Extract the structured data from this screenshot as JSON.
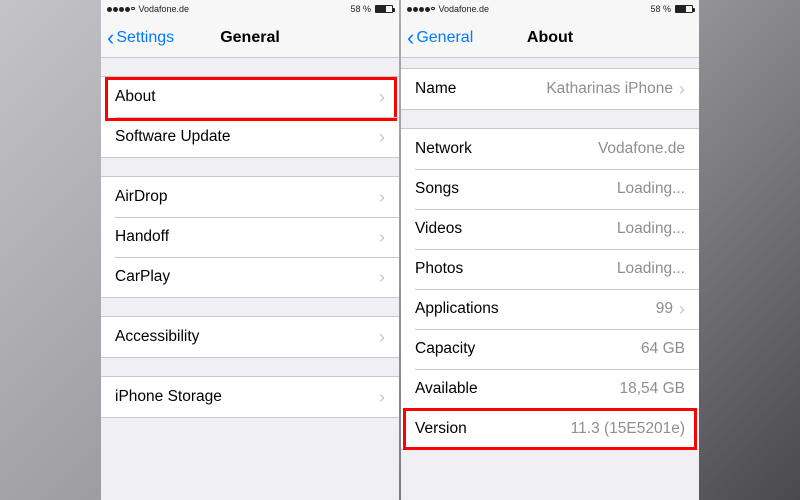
{
  "statusbar": {
    "carrier": "Vodafone.de",
    "battery_pct": "58 %"
  },
  "left": {
    "back_label": "Settings",
    "title": "General",
    "groups": [
      [
        {
          "label": "About",
          "disclosure": true,
          "highlight": true
        },
        {
          "label": "Software Update",
          "disclosure": true
        }
      ],
      [
        {
          "label": "AirDrop",
          "disclosure": true
        },
        {
          "label": "Handoff",
          "disclosure": true
        },
        {
          "label": "CarPlay",
          "disclosure": true
        }
      ],
      [
        {
          "label": "Accessibility",
          "disclosure": true
        }
      ],
      [
        {
          "label": "iPhone Storage",
          "disclosure": true
        }
      ]
    ]
  },
  "right": {
    "back_label": "General",
    "title": "About",
    "name_row": {
      "label": "Name",
      "value": "Katharinas iPhone",
      "disclosure": true
    },
    "rows": [
      {
        "label": "Network",
        "value": "Vodafone.de"
      },
      {
        "label": "Songs",
        "value": "Loading..."
      },
      {
        "label": "Videos",
        "value": "Loading..."
      },
      {
        "label": "Photos",
        "value": "Loading..."
      },
      {
        "label": "Applications",
        "value": "99",
        "disclosure": true
      },
      {
        "label": "Capacity",
        "value": "64 GB"
      },
      {
        "label": "Available",
        "value": "18,54 GB"
      },
      {
        "label": "Version",
        "value": "11.3 (15E5201e)",
        "highlight": true
      }
    ]
  }
}
